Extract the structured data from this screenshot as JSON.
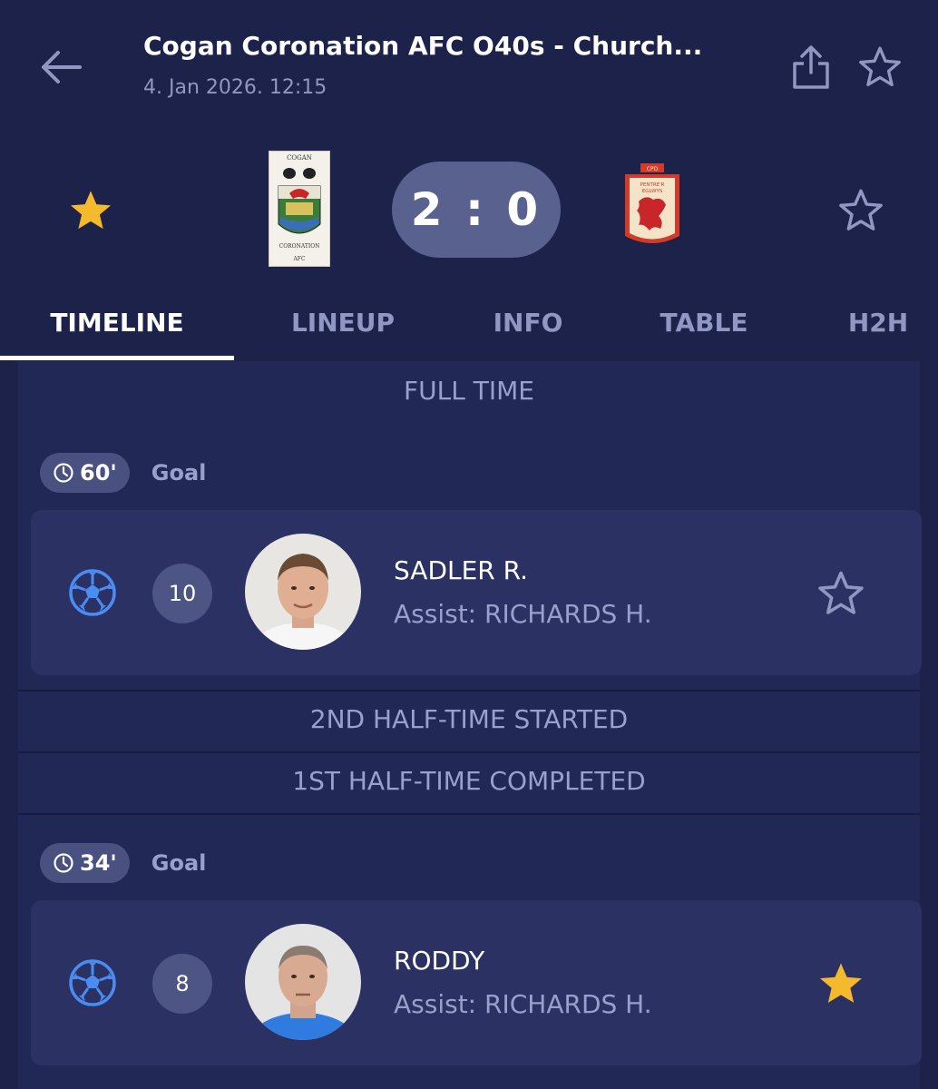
{
  "header": {
    "title": "Cogan Coronation AFC O40s - Church...",
    "datetime": "4. Jan 2026. 12:15"
  },
  "match": {
    "score": "2 : 0",
    "home_favorited": true,
    "away_favorited": false,
    "home_logo_text": [
      "COGAN",
      "CORONATION",
      "AFC"
    ],
    "away_logo_text": [
      "CPD",
      "PENTRE'R",
      "EGLWYS"
    ]
  },
  "tabs": [
    "TIMELINE",
    "LINEUP",
    "INFO",
    "TABLE",
    "H2H"
  ],
  "active_tab": "TIMELINE",
  "timeline": {
    "full_time": "FULL TIME",
    "events": [
      {
        "minute": "60'",
        "type": "Goal",
        "shirt": "10",
        "player": "SADLER R.",
        "assist": "Assist: RICHARDS H.",
        "favorited": false
      },
      {
        "minute": "34'",
        "type": "Goal",
        "shirt": "8",
        "player": "RODDY",
        "assist": "Assist: RICHARDS H.",
        "favorited": true
      }
    ],
    "second_half_started": "2ND HALF-TIME STARTED",
    "first_half_completed": "1ST HALF-TIME COMPLETED"
  },
  "colors": {
    "background": "#1c2249",
    "card": "#2b3263",
    "score_pill": "#59618f",
    "accent_star": "#f5b92e",
    "icon_muted": "#8f97c2",
    "ball_blue": "#4b8cf2"
  },
  "icons": {
    "back": "arrow-left-icon",
    "share": "share-icon",
    "favorite": "star-icon",
    "clock": "clock-icon",
    "goal": "soccer-ball-icon"
  }
}
